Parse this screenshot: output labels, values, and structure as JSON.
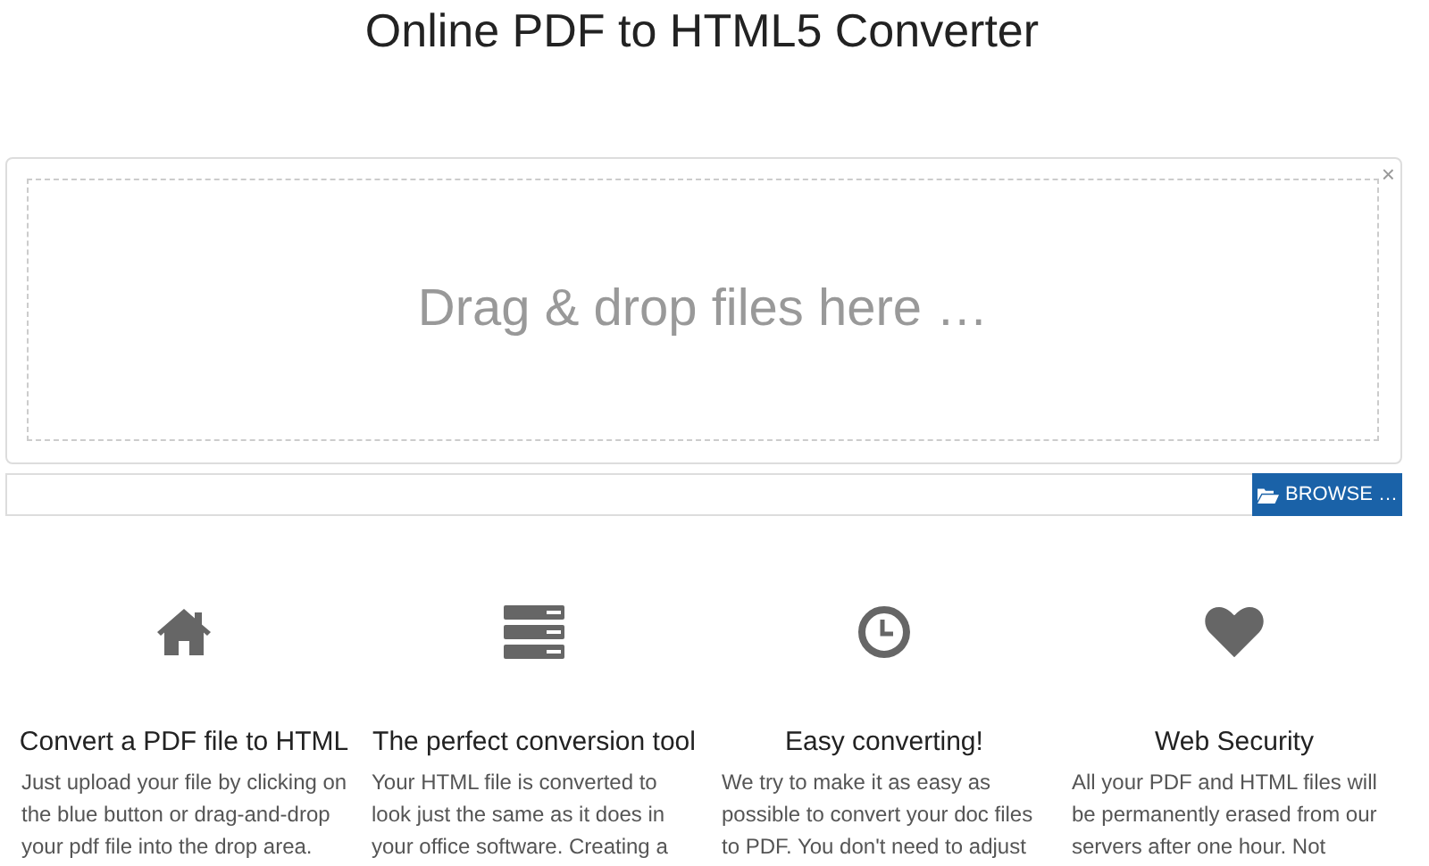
{
  "page": {
    "title": "Online PDF to HTML5 Converter"
  },
  "uploader": {
    "drop_prompt": "Drag & drop files here …",
    "close": "×",
    "browse_button": "BROWSE …"
  },
  "features": [
    {
      "title": "Convert a PDF file to HTML",
      "lines": [
        "Just upload your file by clicking on",
        "the blue button or drag-and-drop",
        "your pdf file into the drop area."
      ]
    },
    {
      "title": "The perfect conversion tool",
      "lines": [
        "Your HTML file is converted to",
        "look just the same as it does in",
        "your office software. Creating a"
      ]
    },
    {
      "title": "Easy converting!",
      "lines": [
        "We try to make it as easy as",
        "possible to convert your doc files",
        "to PDF. You don't need to adjust"
      ]
    },
    {
      "title": "Web Security",
      "lines": [
        "All your PDF and HTML files will",
        "be permanently erased from our",
        "servers after one hour. Not"
      ]
    }
  ]
}
